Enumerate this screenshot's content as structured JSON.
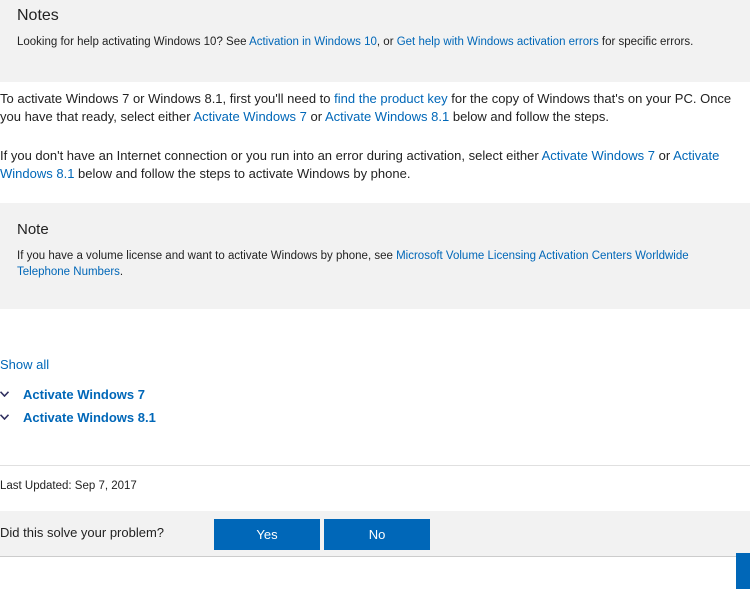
{
  "notes": {
    "title": "Notes",
    "text_before": "Looking for help activating Windows 10? See ",
    "link1": "Activation in Windows 10",
    "text_mid": ", or ",
    "link2": "Get help with Windows activation errors",
    "text_after": " for specific errors."
  },
  "para1": {
    "t1": "To activate Windows 7 or Windows 8.1, first you'll need to ",
    "link_product_key": "find the product key",
    "t2": " for the copy of Windows that's on your PC. Once you have that ready, select either ",
    "link_win7": "Activate Windows 7",
    "t3": " or ",
    "link_win81": "Activate Windows 8.1",
    "t4": " below and follow the steps."
  },
  "para2": {
    "t1": "If you don't have an Internet connection or you run into an error during activation, select either ",
    "link_win7": "Activate Windows 7",
    "t2": " or ",
    "link_win81": "Activate Windows 8.1",
    "t3": " below and follow the steps to activate Windows by phone."
  },
  "note": {
    "title": "Note",
    "text_before": "If you have a volume license and want to activate Windows by phone, see ",
    "link": "Microsoft Volume Licensing Activation Centers Worldwide Telephone Numbers",
    "text_after": "."
  },
  "show_all": "Show all",
  "accordion": [
    {
      "label": "Activate Windows 7",
      "icon": "chevron-down-icon"
    },
    {
      "label": "Activate Windows 8.1",
      "icon": "chevron-down-icon"
    }
  ],
  "last_updated": "Last Updated: Sep 7, 2017",
  "feedback": {
    "question": "Did this solve your problem?",
    "yes": "Yes",
    "no": "No"
  },
  "colors": {
    "link": "#0067b8",
    "button": "#0067b8",
    "panel": "#f2f2f2"
  }
}
